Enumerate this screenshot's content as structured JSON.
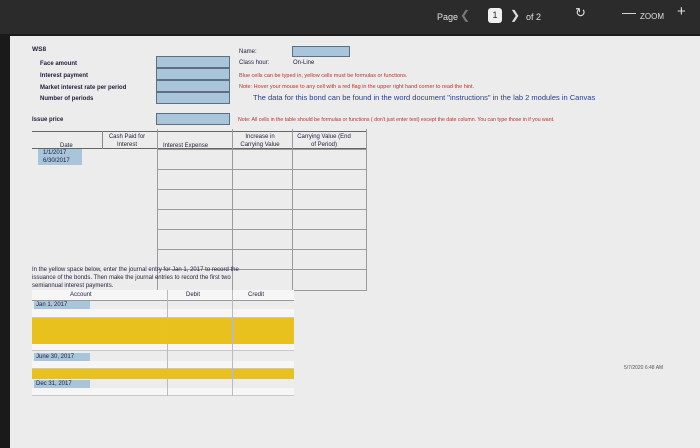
{
  "toolbar": {
    "page_label": "Page",
    "current_page": "1",
    "of_pages": "of 2",
    "zoom_label": "ZOOM",
    "icons": {
      "prev": "chevron-left-icon",
      "next": "chevron-right-icon",
      "rotate": "rotate-icon",
      "minus": "minus-icon",
      "plus": "plus-icon"
    }
  },
  "doc": {
    "ws": "WS8",
    "labels": {
      "face_amount": "Face amount",
      "interest_payment": "Interest payment",
      "market_rate": "Market interest rate per period",
      "num_periods": "Number of periods",
      "issue_price": "Issue price"
    },
    "name_label": "Name:",
    "class_hour_label": "Class hour:",
    "class_hour_value": "On-Line",
    "blue_note": "Blue cells can be typed in, yellow cells must be formulas or functions.",
    "hover_note": "Note: Hover your mouse to any cell with a red flag in the upper right hand corner to read the hint.",
    "instructions_note": "The data for this bond can be found in the word document \"instructions\" in the lab 2 modules in Canvas",
    "formula_note": "Note: All cells in the table should be formulas or functions ( don't just enter text) except the date column. You can type those in if you want.",
    "table": {
      "headers": [
        "Date",
        "Cash Paid for Interest",
        "Interest Expense",
        "Increase in Carrying Value",
        "Carrying Value (End of Period)"
      ],
      "dates": [
        "1/1/2017",
        "6/30/2017"
      ]
    },
    "journal_note": [
      "In the yellow space below, enter the journal entry for Jan 1, 2017 to record the",
      "issuance of the bonds. Then make the journal entries to record the first two",
      "semiannual interest payments."
    ],
    "journal": {
      "headers": [
        "Account",
        "Debit",
        "Credit"
      ],
      "dates": [
        "Jan 1, 2017",
        "June 30, 2017",
        "Dec 31, 2017"
      ]
    },
    "timestamp": "5/7/2020 6:48 AM"
  },
  "colors": {
    "input_blue": "#a9c5dc",
    "formula_yellow": "#e9c11f",
    "hint_red": "#b8322c"
  }
}
